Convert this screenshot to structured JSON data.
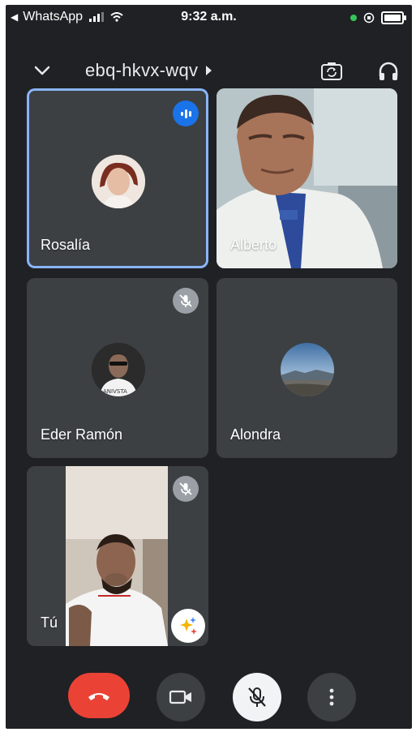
{
  "status_bar": {
    "back_app": "WhatsApp",
    "time": "9:32 a.m."
  },
  "header": {
    "meeting_code": "ebq-hkvx-wqv",
    "collapse_icon": "chevron-down-icon",
    "camera_flip_icon": "camera-flip-icon",
    "audio_output_icon": "headphones-icon"
  },
  "participants": [
    {
      "name": "Rosalía",
      "state": "speaking",
      "media": "avatar"
    },
    {
      "name": "Alberto",
      "state": "video",
      "media": "video"
    },
    {
      "name": "Eder Ramón",
      "state": "muted",
      "media": "avatar"
    },
    {
      "name": "Alondra",
      "state": "unmuted",
      "media": "avatar"
    },
    {
      "name": "Tú",
      "state": "muted",
      "media": "video"
    }
  ],
  "controls": {
    "end_call_icon": "phone-hangup-icon",
    "camera_icon": "video-camera-icon",
    "mic_icon": "mic-off-icon",
    "more_icon": "more-vertical-icon"
  },
  "colors": {
    "background": "#202124",
    "tile": "#3c4043",
    "active_border": "#8ab4f8",
    "speaking_badge": "#1a73e8",
    "end_call": "#ea4335"
  }
}
